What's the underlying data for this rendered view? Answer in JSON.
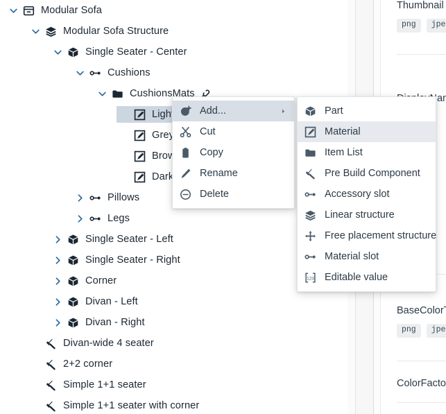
{
  "tree": {
    "nodes": [
      {
        "label": "Modular Sofa",
        "icon": "package-icon",
        "indent": 0,
        "twisty": "expanded",
        "selected": false,
        "trailing_icon": null
      },
      {
        "label": "Modular Sofa Structure",
        "icon": "layers-icon",
        "indent": 1,
        "twisty": "expanded",
        "selected": false,
        "trailing_icon": null
      },
      {
        "label": "Single Seater - Center",
        "icon": "cube-icon",
        "indent": 2,
        "twisty": "expanded",
        "selected": false,
        "trailing_icon": null
      },
      {
        "label": "Cushions",
        "icon": "slot-icon",
        "indent": 3,
        "twisty": "expanded",
        "selected": false,
        "trailing_icon": null
      },
      {
        "label": "CushionsMats",
        "icon": "folder-icon",
        "indent": 4,
        "twisty": "expanded",
        "selected": false,
        "trailing_icon": "link-icon"
      },
      {
        "label": "Light",
        "icon": "material-icon",
        "indent": 5,
        "twisty": "none",
        "selected": true,
        "trailing_icon": null
      },
      {
        "label": "Grey",
        "icon": "material-icon",
        "indent": 5,
        "twisty": "none",
        "selected": false,
        "trailing_icon": null
      },
      {
        "label": "Brown",
        "icon": "material-icon",
        "indent": 5,
        "twisty": "none",
        "selected": false,
        "trailing_icon": null
      },
      {
        "label": "Dark",
        "icon": "material-icon",
        "indent": 5,
        "twisty": "none",
        "selected": false,
        "trailing_icon": null
      },
      {
        "label": "Pillows",
        "icon": "slot-icon",
        "indent": 3,
        "twisty": "collapsed",
        "selected": false,
        "trailing_icon": null
      },
      {
        "label": "Legs",
        "icon": "slot-icon",
        "indent": 3,
        "twisty": "collapsed",
        "selected": false,
        "trailing_icon": null
      },
      {
        "label": "Single Seater - Left",
        "icon": "cube-icon",
        "indent": 2,
        "twisty": "collapsed",
        "selected": false,
        "trailing_icon": null
      },
      {
        "label": "Single Seater - Right",
        "icon": "cube-icon",
        "indent": 2,
        "twisty": "collapsed",
        "selected": false,
        "trailing_icon": null
      },
      {
        "label": "Corner",
        "icon": "cube-icon",
        "indent": 2,
        "twisty": "collapsed",
        "selected": false,
        "trailing_icon": null
      },
      {
        "label": "Divan - Left",
        "icon": "cube-icon",
        "indent": 2,
        "twisty": "collapsed",
        "selected": false,
        "trailing_icon": null
      },
      {
        "label": "Divan - Right",
        "icon": "cube-icon",
        "indent": 2,
        "twisty": "collapsed",
        "selected": false,
        "trailing_icon": null
      },
      {
        "label": "Divan-wide 4 seater",
        "icon": "hammer-icon",
        "indent": 1,
        "twisty": "none",
        "selected": false,
        "trailing_icon": null
      },
      {
        "label": "2+2 corner",
        "icon": "hammer-icon",
        "indent": 1,
        "twisty": "none",
        "selected": false,
        "trailing_icon": null
      },
      {
        "label": "Simple 1+1 seater",
        "icon": "hammer-icon",
        "indent": 1,
        "twisty": "none",
        "selected": false,
        "trailing_icon": null
      },
      {
        "label": "Simple 1+1 seater with corner",
        "icon": "hammer-icon",
        "indent": 1,
        "twisty": "none",
        "selected": false,
        "trailing_icon": null
      }
    ]
  },
  "context_menu": {
    "items": [
      {
        "label": "Add...",
        "icon": "add-circle-icon",
        "active": true,
        "has_submenu": true
      },
      {
        "label": "Cut",
        "icon": "scissors-icon",
        "active": false,
        "has_submenu": false
      },
      {
        "label": "Copy",
        "icon": "clipboard-icon",
        "active": false,
        "has_submenu": false
      },
      {
        "label": "Rename",
        "icon": "pencil-icon",
        "active": false,
        "has_submenu": false
      },
      {
        "label": "Delete",
        "icon": "minus-circle-icon",
        "active": false,
        "has_submenu": false
      }
    ]
  },
  "add_submenu": {
    "items": [
      {
        "label": "Part",
        "icon": "cube-icon",
        "active": false
      },
      {
        "label": "Material",
        "icon": "material-icon",
        "active": true
      },
      {
        "label": "Item List",
        "icon": "folder-icon",
        "active": false
      },
      {
        "label": "Pre Build Component",
        "icon": "hammer-icon",
        "active": false
      },
      {
        "label": "Accessory slot",
        "icon": "slot-icon",
        "active": false
      },
      {
        "label": "Linear structure",
        "icon": "layers-icon",
        "active": false
      },
      {
        "label": "Free placement structure",
        "icon": "move-icon",
        "active": false
      },
      {
        "label": "Material slot",
        "icon": "slot-icon",
        "active": false
      },
      {
        "label": "Editable value",
        "icon": "editable-value-icon",
        "active": false
      }
    ]
  },
  "properties": {
    "groups": [
      {
        "title": "Thumbnail",
        "chips": [
          "png",
          "jpeg"
        ]
      },
      {
        "title": "DisplayName",
        "chips": []
      },
      {
        "title": "BaseColorTexture",
        "chips": [
          "png",
          "jpeg"
        ]
      },
      {
        "title": "ColorFactor",
        "chips": []
      }
    ]
  },
  "colors": {
    "selection": "#ccd6e0",
    "menu_active": "#d7dee6",
    "submenu_active": "#e6eaee",
    "twisty": "#2d6a9f",
    "text": "#1b2733"
  }
}
